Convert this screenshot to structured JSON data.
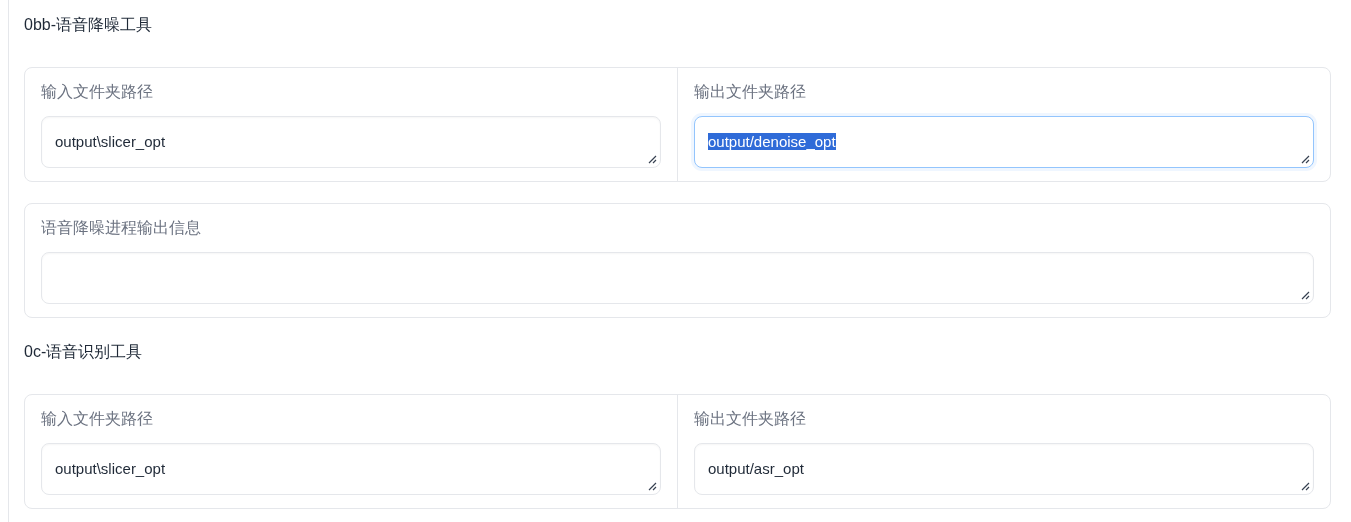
{
  "sections": [
    {
      "title": "0bb-语音降噪工具",
      "panels": [
        {
          "fields": [
            {
              "label": "输入文件夹路径",
              "value": "output\\slicer_opt",
              "focused": false
            },
            {
              "label": "输出文件夹路径",
              "value": "output/denoise_opt",
              "focused": true,
              "text_highlighted": true
            }
          ]
        },
        {
          "fields": [
            {
              "label": "语音降噪进程输出信息",
              "focused": false
            }
          ]
        }
      ]
    },
    {
      "title": "0c-语音识别工具",
      "panels": [
        {
          "fields": [
            {
              "label": "输入文件夹路径",
              "value": "output\\slicer_opt",
              "focused": false
            },
            {
              "label": "输出文件夹路径",
              "value": "output/asr_opt",
              "focused": false
            }
          ]
        }
      ]
    }
  ]
}
